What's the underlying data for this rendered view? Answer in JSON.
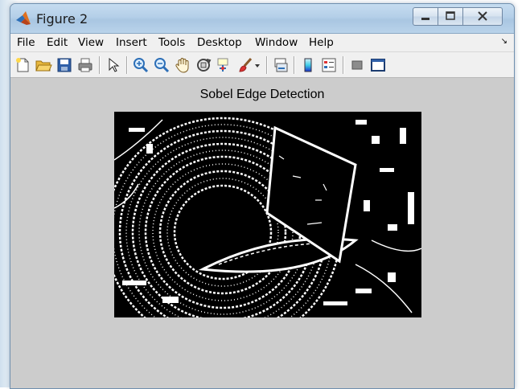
{
  "window": {
    "title": "Figure 2",
    "title_icon": "matlab-icon",
    "controls": [
      "minimize-icon",
      "maximize-icon",
      "close-icon"
    ]
  },
  "menu": {
    "items": [
      "File",
      "Edit",
      "View",
      "Insert",
      "Tools",
      "Desktop",
      "Window",
      "Help"
    ],
    "overflow_icon": "chevron-right-icon"
  },
  "toolbar": {
    "buttons": [
      "new-figure-icon",
      "open-file-icon",
      "save-icon",
      "print-icon",
      "edit-plot-icon",
      "zoom-in-icon",
      "zoom-out-icon",
      "pan-icon",
      "rotate-3d-icon",
      "data-cursor-icon",
      "brush-icon",
      "brush-dropdown-icon",
      "link-plot-icon",
      "insert-colorbar-icon",
      "insert-legend-icon",
      "hide-plot-tools-icon",
      "show-plot-tools-icon"
    ]
  },
  "figure": {
    "plot_title": "Sobel Edge Detection",
    "image_description_icon": "edge-map-image",
    "background_color": "#cccccc"
  }
}
